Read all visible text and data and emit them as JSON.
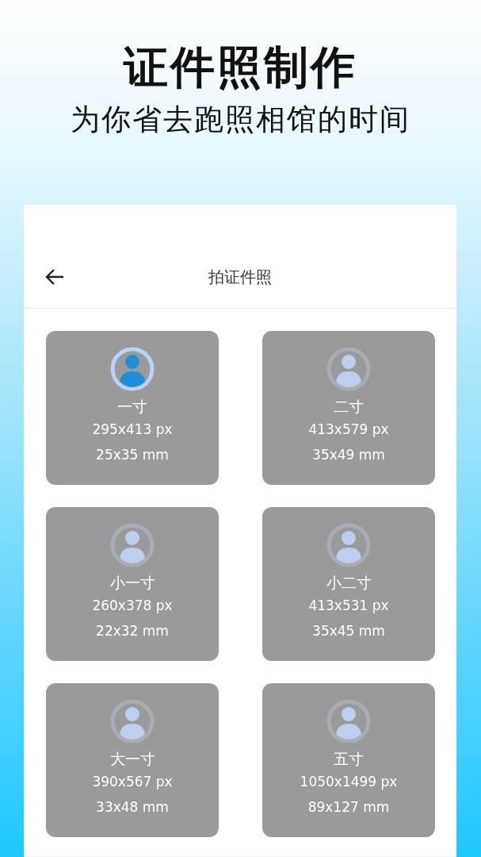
{
  "headline": "证件照制作",
  "subheadline": "为你省去跑照相馆的时间",
  "app": {
    "title": "拍证件照",
    "sizes": [
      {
        "name": "一寸",
        "pixels": "295x413 px",
        "millimeters": "25x35 mm",
        "selected": true
      },
      {
        "name": "二寸",
        "pixels": "413x579 px",
        "millimeters": "35x49 mm",
        "selected": false
      },
      {
        "name": "小一寸",
        "pixels": "260x378 px",
        "millimeters": "22x32 mm",
        "selected": false
      },
      {
        "name": "小二寸",
        "pixels": "413x531 px",
        "millimeters": "35x45 mm",
        "selected": false
      },
      {
        "name": "大一寸",
        "pixels": "390x567 px",
        "millimeters": "33x48 mm",
        "selected": false
      },
      {
        "name": "五寸",
        "pixels": "1050x1499 px",
        "millimeters": "89x127 mm",
        "selected": false
      }
    ]
  }
}
